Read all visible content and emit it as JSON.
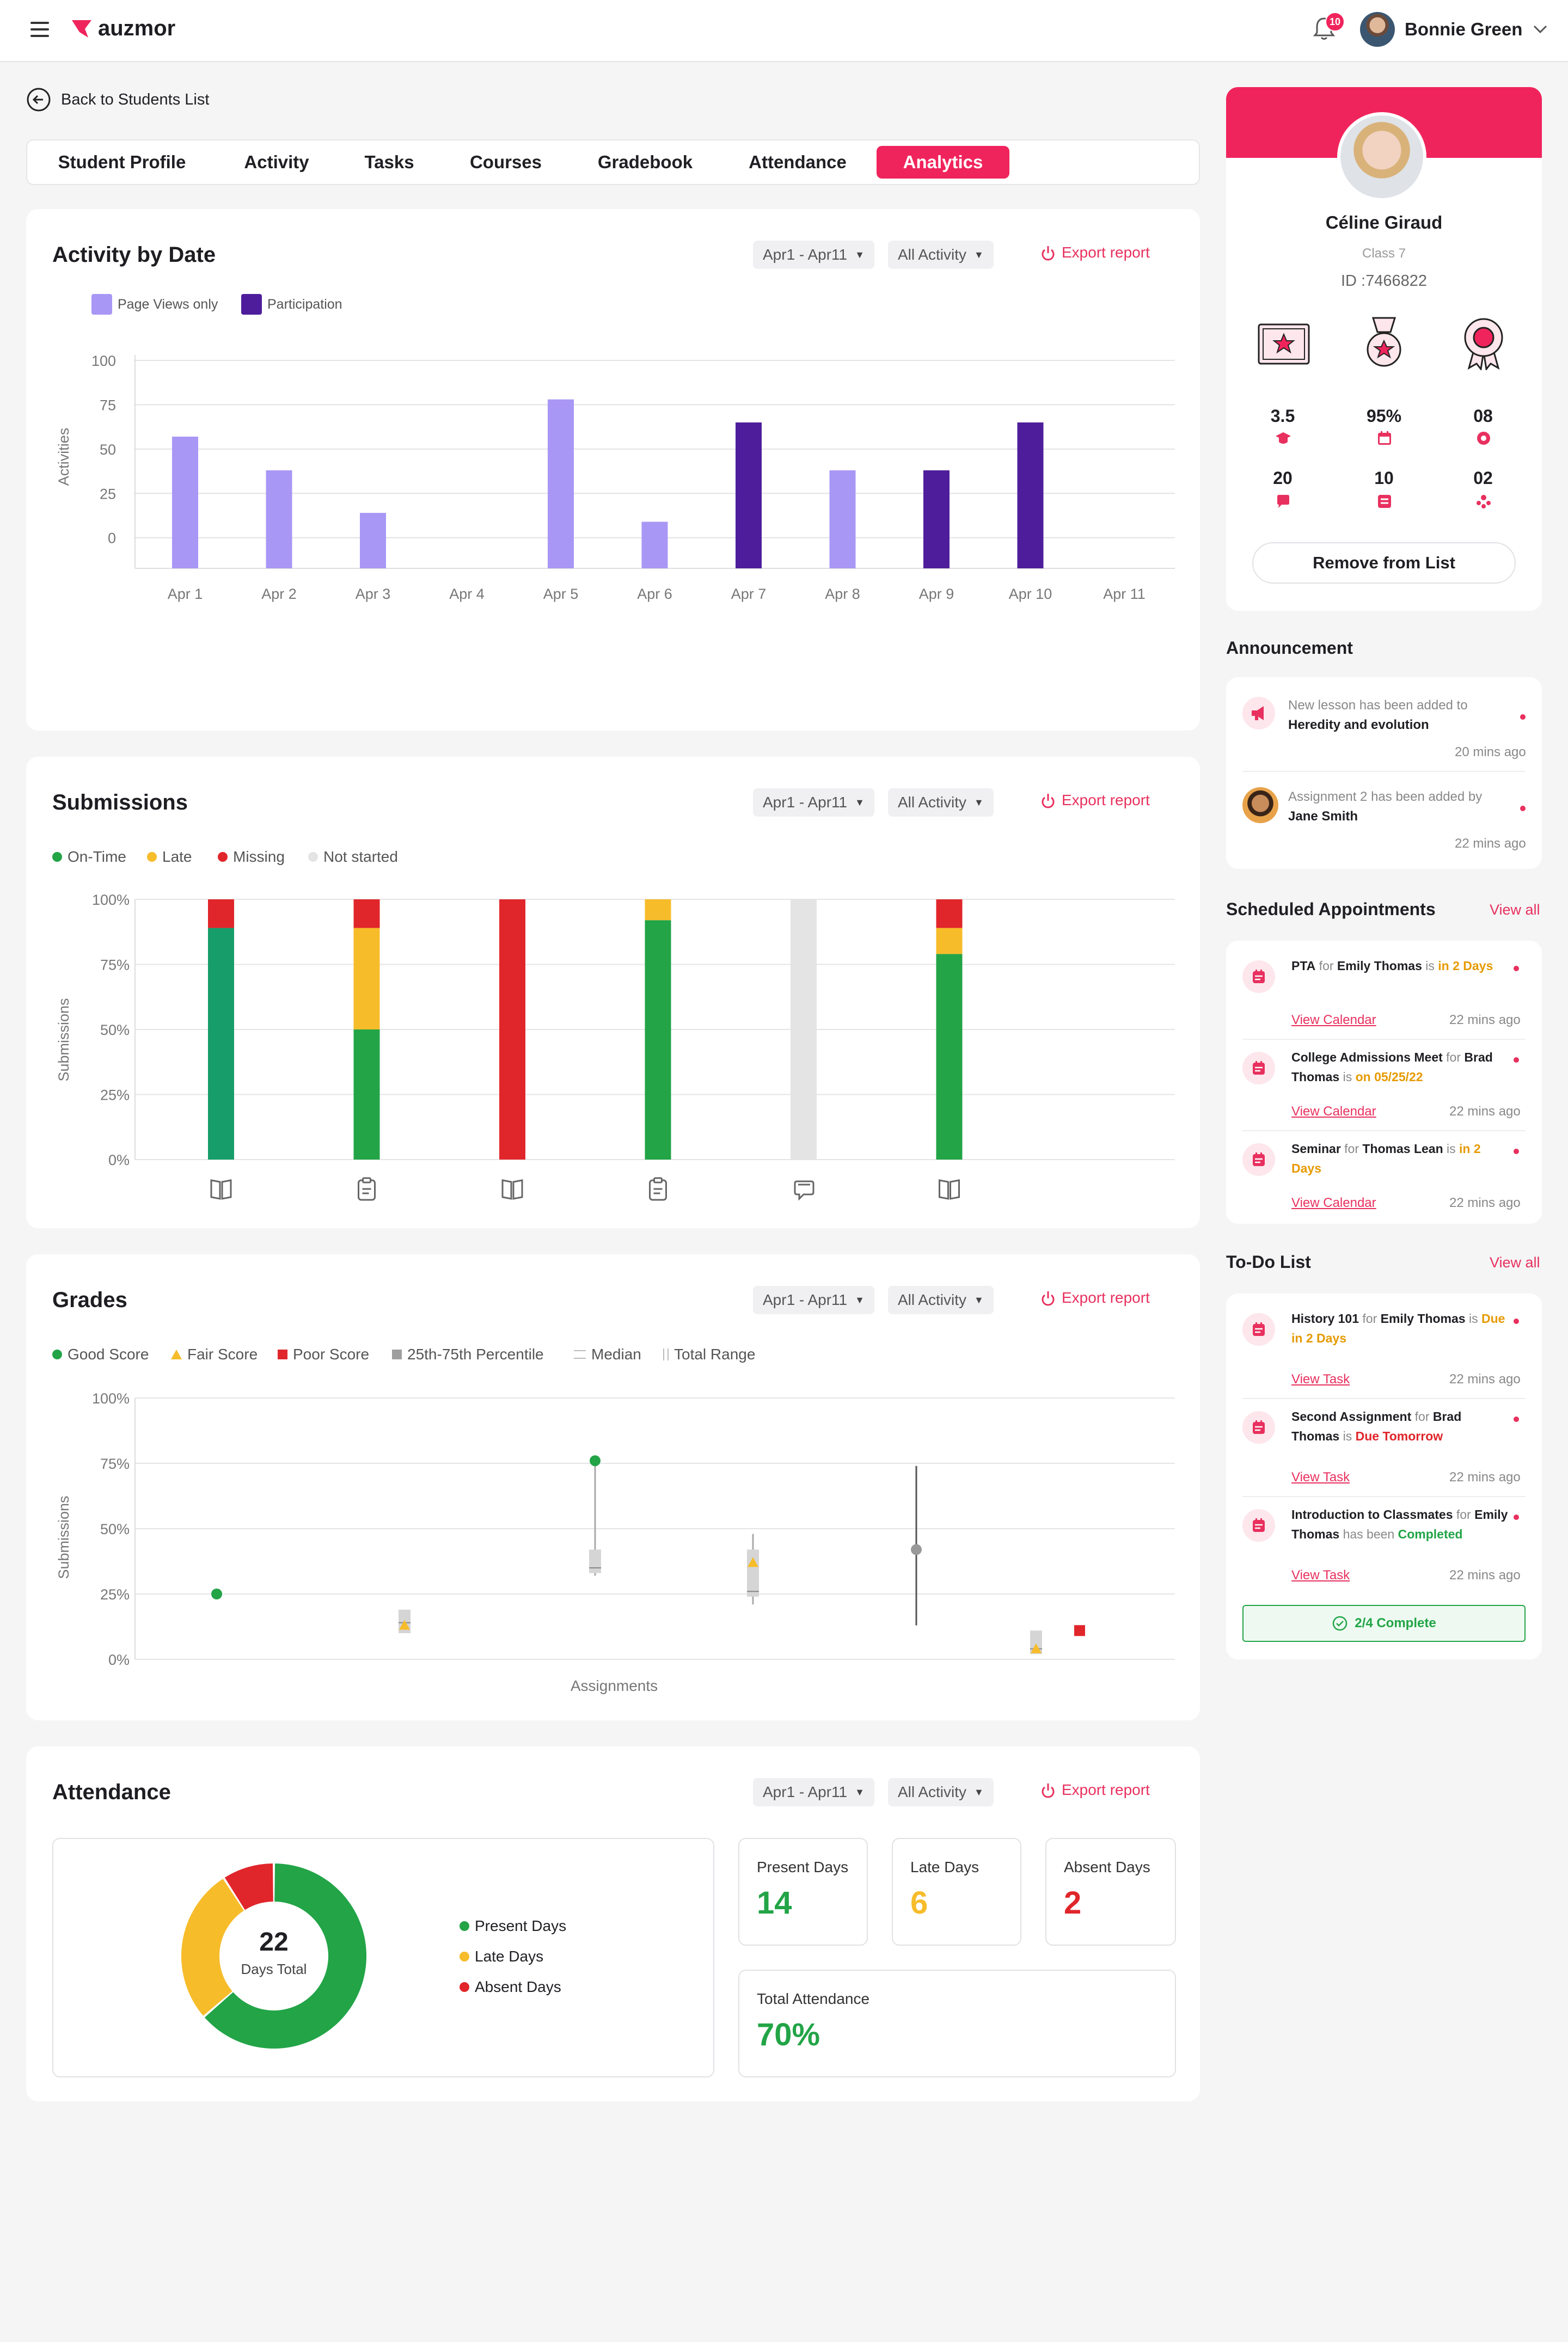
{
  "app": {
    "brand": "auzmor",
    "notif_count": "10",
    "user_name": "Bonnie Green"
  },
  "nav": {
    "back_label": "Back to Students List",
    "tabs": [
      "Student Profile",
      "Activity",
      "Tasks",
      "Courses",
      "Gradebook",
      "Attendance",
      "Analytics"
    ],
    "active_tab": "Analytics"
  },
  "controls": {
    "date_range": "Apr1 - Apr11",
    "filter": "All Activity",
    "export": "Export report"
  },
  "colors": {
    "accent": "#f0245c",
    "page_views": "#a997f5",
    "participation": "#4e1d9b",
    "on_time": "#22a447",
    "late": "#f7bc2a",
    "missing": "#e0262b",
    "not_started": "#e4e4e4"
  },
  "activity": {
    "title": "Activity by Date",
    "legend": [
      "Page Views only",
      "Participation"
    ],
    "chart_data": {
      "type": "bar",
      "title": "Activity by Date",
      "xlabel": "",
      "ylabel": "Activities",
      "categories": [
        "Apr 1",
        "Apr 2",
        "Apr 3",
        "Apr 4",
        "Apr 5",
        "Apr 6",
        "Apr 7",
        "Apr 8",
        "Apr 9",
        "Apr 10",
        "Apr 11"
      ],
      "yticks": [
        100,
        75,
        50,
        25,
        0
      ],
      "ylim": [
        -5,
        100
      ],
      "series": [
        {
          "name": "Page Views only",
          "values": [
            57,
            38,
            14,
            null,
            78,
            9,
            null,
            38,
            null,
            null,
            null
          ]
        },
        {
          "name": "Participation",
          "values": [
            null,
            null,
            null,
            null,
            null,
            null,
            65,
            null,
            38,
            65,
            null
          ]
        }
      ]
    }
  },
  "submissions": {
    "title": "Submissions",
    "legend": [
      "On-Time",
      "Late",
      "Missing",
      "Not started"
    ],
    "chart_data": {
      "type": "bar",
      "stacked": true,
      "ylabel": "Submissions",
      "yticks": [
        "100%",
        "75%",
        "50%",
        "25%",
        "0%"
      ],
      "ylim": [
        0,
        100
      ],
      "categories_icons": [
        "book-icon",
        "clipboard-icon",
        "book-icon",
        "clipboard-icon",
        "chat-icon",
        "book-icon"
      ],
      "series": [
        {
          "name": "On-Time",
          "values": [
            89,
            50,
            0,
            92,
            0,
            79
          ]
        },
        {
          "name": "Late",
          "values": [
            0,
            39,
            0,
            8,
            0,
            10
          ]
        },
        {
          "name": "Missing",
          "values": [
            11,
            11,
            100,
            0,
            0,
            11
          ]
        },
        {
          "name": "Not started",
          "values": [
            0,
            0,
            0,
            0,
            100,
            0
          ]
        }
      ]
    }
  },
  "grades": {
    "title": "Grades",
    "legend": [
      "Good Score",
      "Fair Score",
      "Poor Score",
      "25th-75th Percentile",
      "Median",
      "Total Range"
    ],
    "chart_data": {
      "type": "scatter",
      "xlabel": "Assignments",
      "ylabel": "Submissions",
      "yticks": [
        "100%",
        "75%",
        "50%",
        "25%",
        "0%"
      ],
      "ylim": [
        0,
        100
      ],
      "points": [
        {
          "x": 1,
          "score": 25,
          "kind": "Good Score"
        },
        {
          "x": 2,
          "score": 13,
          "kind": "Fair Score",
          "q1": 10,
          "q3": 19,
          "median": 14
        },
        {
          "x": 3,
          "score": 76,
          "kind": "Good Score",
          "min": 32,
          "max": 76,
          "q1": 33,
          "q3": 42,
          "median": 35
        },
        {
          "x": 4,
          "score": 37,
          "kind": "Fair Score",
          "min": 21,
          "max": 48,
          "q1": 24,
          "q3": 42,
          "median": 26
        },
        {
          "x": 5,
          "score": 42,
          "kind": "Median",
          "min": 13,
          "max": 74
        },
        {
          "x": 6,
          "score": 4,
          "kind": "Fair Score",
          "q1": 2,
          "q3": 11,
          "median": 4
        },
        {
          "x": 7,
          "score": 11,
          "kind": "Poor Score"
        }
      ]
    }
  },
  "attendance": {
    "title": "Attendance",
    "total": "22",
    "total_label": "Days Total",
    "legend": [
      "Present Days",
      "Late Days",
      "Absent Days"
    ],
    "chart_data": {
      "type": "pie",
      "donut": true,
      "labels": [
        "Present Days",
        "Late Days",
        "Absent Days"
      ],
      "values": [
        14,
        6,
        2
      ]
    },
    "present_label": "Present Days",
    "present": "14",
    "late_label": "Late Days",
    "late": "6",
    "absent_label": "Absent Days",
    "absent": "2",
    "total_att_label": "Total Attendance",
    "total_att": "70%"
  },
  "profile": {
    "name": "Céline Giraud",
    "class": "Class 7",
    "id": "ID :7466822",
    "stats": [
      "3.5",
      "95%",
      "08",
      "20",
      "10",
      "02"
    ],
    "remove": "Remove from List"
  },
  "announcement": {
    "title": "Announcement",
    "items": [
      {
        "text": "New lesson has been added to",
        "bold": "Heredity and evolution",
        "time": "20 mins ago"
      },
      {
        "text": "Assignment 2 has been added by",
        "bold": "Jane Smith",
        "time": "22 mins ago"
      }
    ]
  },
  "appointments": {
    "title": "Scheduled Appointments",
    "view_all": "View all",
    "items": [
      {
        "a": "PTA",
        "b": " for ",
        "c": "Emily Thomas",
        "d": " is ",
        "e": "in 2 Days",
        "link": "View Calendar",
        "time": "22 mins ago"
      },
      {
        "a": "College Admissions Meet",
        "b": " for ",
        "c": "Brad Thomas",
        "d": " is ",
        "e": "on 05/25/22",
        "link": "View Calendar",
        "time": "22 mins ago"
      },
      {
        "a": "Seminar",
        "b": " for ",
        "c": "Thomas Lean",
        "d": " is ",
        "e": "in 2 Days",
        "link": "View Calendar",
        "time": "22 mins ago"
      }
    ]
  },
  "todo": {
    "title": "To-Do List",
    "view_all": "View all",
    "items": [
      {
        "a": "History 101",
        "b": " for ",
        "c": "Emily Thomas",
        "d": " is ",
        "e": "Due in 2 Days",
        "link": "View Task",
        "time": "22 mins ago"
      },
      {
        "a": "Second Assignment",
        "b": " for ",
        "c": "Brad Thomas",
        "d": " is ",
        "e": "Due Tomorrow",
        "link": "View Task",
        "time": "22 mins ago"
      },
      {
        "a": "Introduction to Classmates",
        "b": " for ",
        "c": "Emily Thomas",
        "d": " has been ",
        "e": "Completed",
        "link": "View Task",
        "time": "22 mins ago"
      }
    ],
    "complete": "2/4 Complete",
    "complete_fraction": 0.5
  }
}
